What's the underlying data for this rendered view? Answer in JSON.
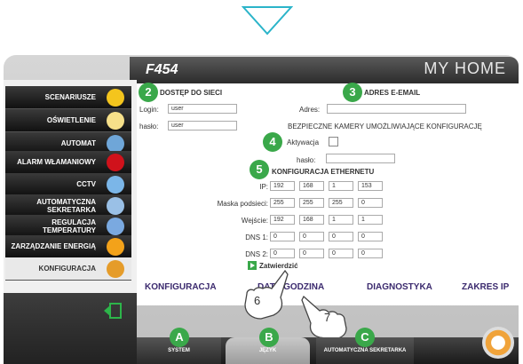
{
  "header": {
    "title": "F454",
    "brand": "MY HOME"
  },
  "sidebar": {
    "items": [
      {
        "label": "SCENARIUSZE",
        "icon": "sun-icon",
        "color": "#f4c51d"
      },
      {
        "label": "OŚWIETLENIE",
        "icon": "lamp-icon",
        "color": "#f6e08a"
      },
      {
        "label": "AUTOMAT",
        "icon": "automation-arrows-icon",
        "color": "#6fa6d8"
      },
      {
        "label": "ALARM WŁAMANIOWY",
        "icon": "alarm-icon",
        "color": "#d0121b"
      },
      {
        "label": "CCTV",
        "icon": "camera-icon",
        "color": "#7bb6e8"
      },
      {
        "label": "AUTOMATYCZNA SEKRETARKA",
        "icon": "phone-icon",
        "color": "#9ac0e6"
      },
      {
        "label": "REGULACJA TEMPERATURY",
        "icon": "thermometer-icon",
        "color": "#7aa9e0"
      },
      {
        "label": "ZARZĄDZANIE ENERGIĄ",
        "icon": "energy-icon",
        "color": "#f3a21a"
      },
      {
        "label": "KONFIGURACJA",
        "icon": "gear-icon",
        "color": "#e59c2a"
      }
    ]
  },
  "network": {
    "num": "2",
    "title": "DOSTĘP DO SIECI",
    "login_label": "Login:",
    "login_value": "user",
    "pass_label": "hasło:",
    "pass_value": "user"
  },
  "email": {
    "num": "3",
    "title": "ADRES E-EMAIL",
    "address_label": "Adres:",
    "address_value": ""
  },
  "camera": {
    "title": "BEZPIECZNE KAMERY UMOŻLIWIAJĄCE KONFIGURACJĘ",
    "num": "4",
    "activation_label": "Aktywacja",
    "pass_label": "hasło:",
    "pass_value": ""
  },
  "ethernet": {
    "num": "5",
    "title": "KONFIGURACJA ETHERNETU",
    "rows": [
      {
        "label": "IP:",
        "values": [
          "192",
          "168",
          "1",
          "153"
        ]
      },
      {
        "label": "Maska podsieci:",
        "values": [
          "255",
          "255",
          "255",
          "0"
        ]
      },
      {
        "label": "Wejście:",
        "values": [
          "192",
          "168",
          "1",
          "1"
        ]
      },
      {
        "label": "DNS 1:",
        "values": [
          "0",
          "0",
          "0",
          "0"
        ]
      },
      {
        "label": "DNS 2:",
        "values": [
          "0",
          "0",
          "0",
          "0"
        ]
      }
    ],
    "confirm_label": "Zatwierdzić"
  },
  "tabs": [
    "KONFIGURACJA",
    "DATA/GODZINA",
    "DIAGNOSTYKA",
    "ZAKRES IP"
  ],
  "callouts": {
    "six": "6",
    "seven": "7"
  },
  "bottom_tabs": [
    {
      "letter": "A",
      "label": "SYSTEM"
    },
    {
      "letter": "B",
      "label": "JĘZYK"
    },
    {
      "letter": "C",
      "label": "AUTOMATYCZNA SEKRETARKA"
    }
  ],
  "colors": {
    "accent_green": "#3aa84a",
    "tab_text": "#3b2a6e",
    "arrow": "#2bb4c9"
  }
}
